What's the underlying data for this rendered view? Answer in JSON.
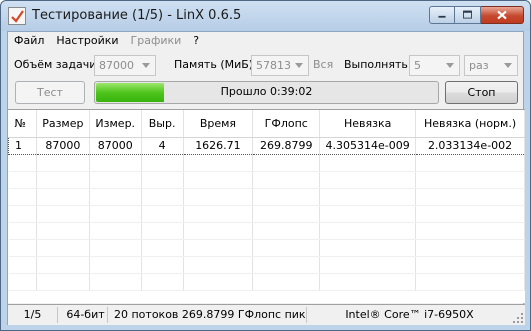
{
  "window": {
    "title": "Тестирование (1/5) - LinX 0.6.5",
    "icons": {
      "app": "app-icon",
      "min": "minimize-icon",
      "max": "maximize-icon",
      "close": "close-icon"
    }
  },
  "menu": [
    "Файл",
    "Настройки",
    "Графики",
    "?"
  ],
  "controls": {
    "size_label": "Объём задачи:",
    "size_value": "87000",
    "memory_label": "Память (МиБ):",
    "memory_value": "57813",
    "memory_all": "Вся",
    "run_label": "Выполнять:",
    "run_value": "5",
    "run_unit": "раз",
    "test_button": "Тест",
    "stop_button": "Стоп",
    "progress_text": "Прошло 0:39:02",
    "progress_fraction": 0.2
  },
  "table": {
    "columns": [
      "№",
      "Размер",
      "Измер.",
      "Выр.",
      "Время",
      "ГФлопс",
      "Невязка",
      "Невязка (норм.)"
    ],
    "rows": [
      [
        "1",
        "87000",
        "87000",
        "4",
        "1626.71",
        "269.8799",
        "4.305314e-009",
        "2.033134e-002"
      ]
    ]
  },
  "status": {
    "run": "1/5",
    "bits": "64-бит",
    "perf": "20 потоков 269.8799 ГФлопс пик",
    "cpu": "Intel® Core™ i7-6950X"
  },
  "colors": {
    "progress_fill": "#4fc51d",
    "title_bar": "#bcd3ea",
    "close_button": "#c64a2f"
  }
}
